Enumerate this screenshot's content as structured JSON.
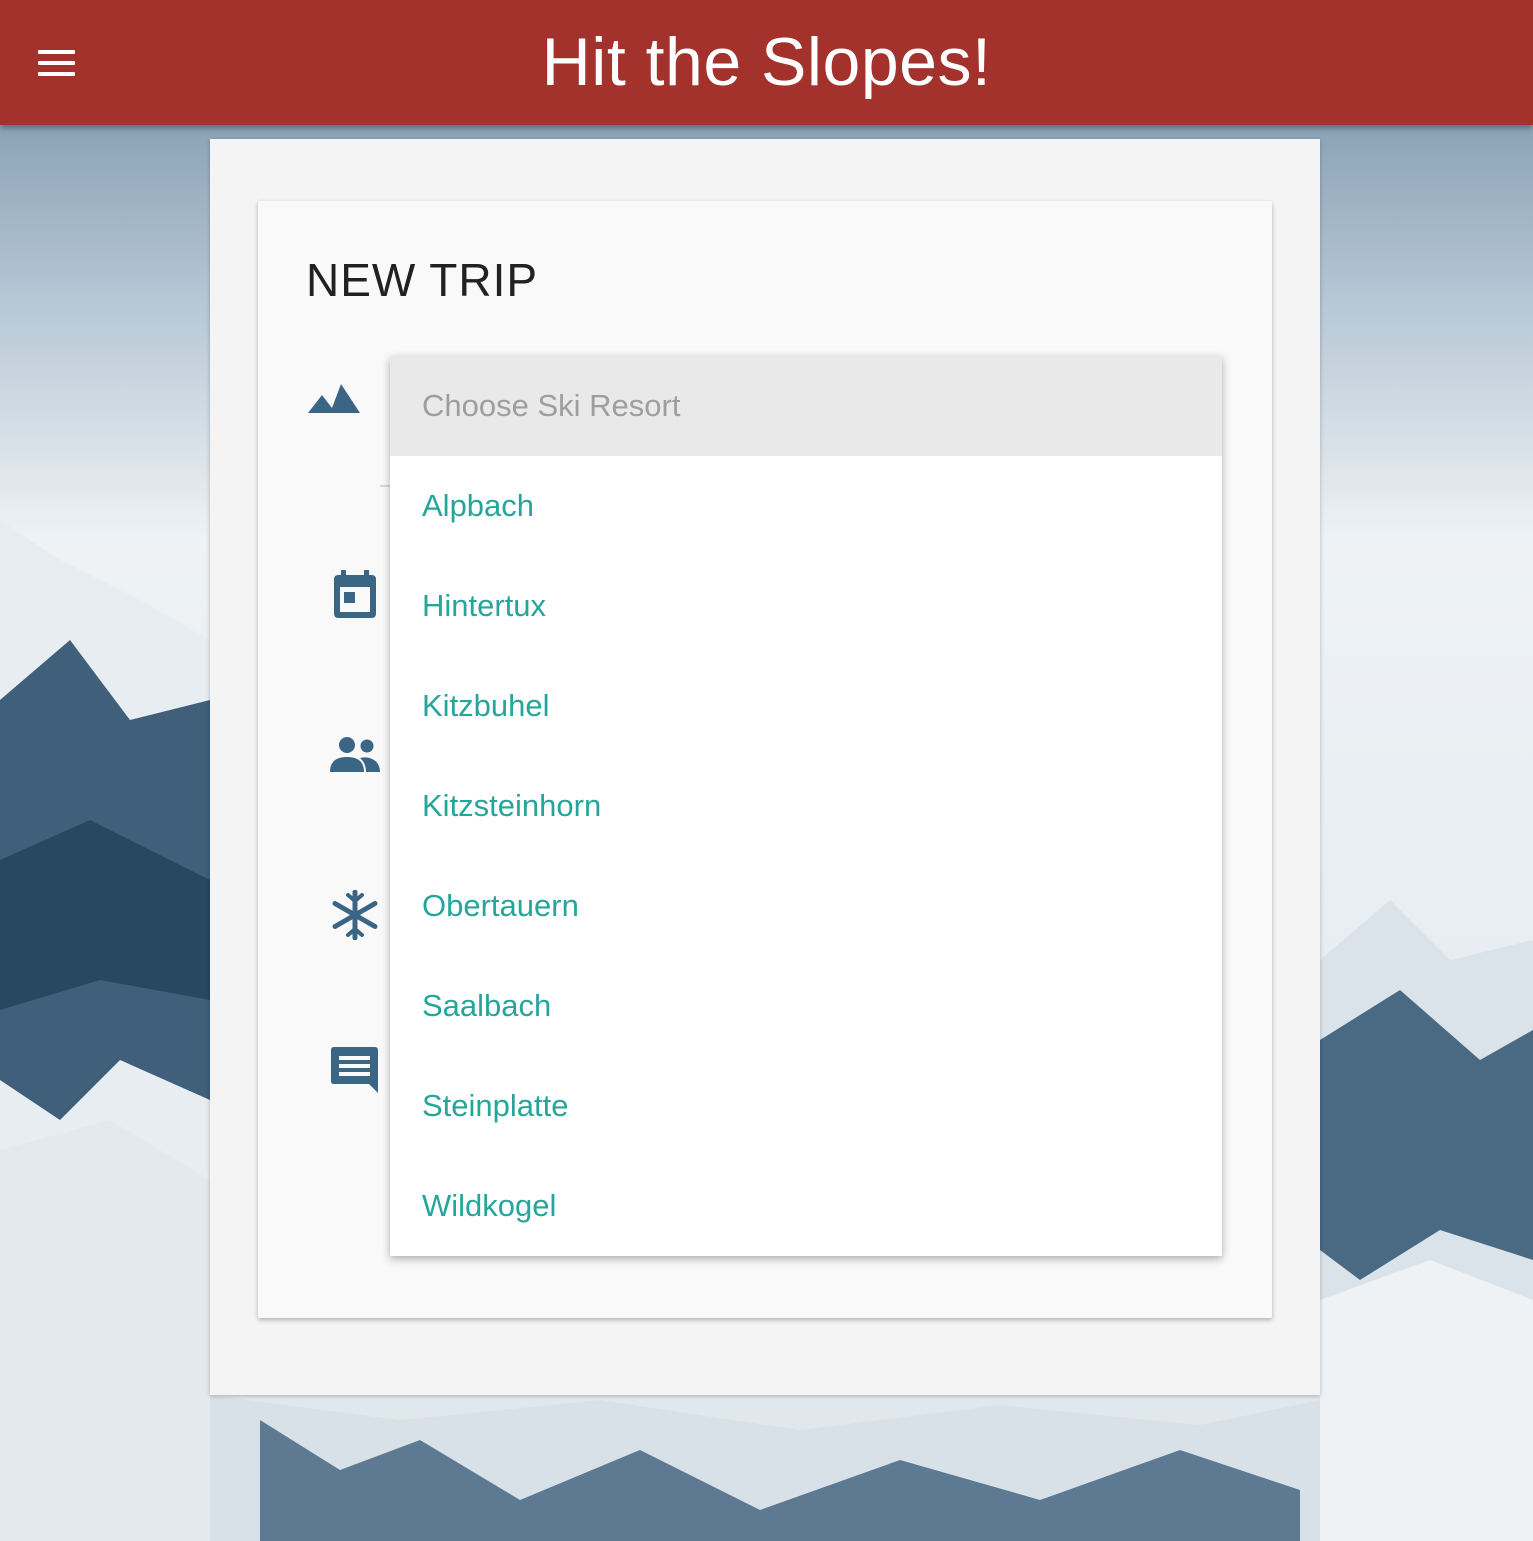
{
  "header": {
    "title": "Hit the Slopes!",
    "menu_icon": "hamburger-menu-icon",
    "background_color": "#a3322d"
  },
  "form": {
    "title": "NEW TRIP",
    "fields": [
      {
        "icon": "mountain-icon"
      },
      {
        "icon": "calendar-icon"
      },
      {
        "icon": "people-icon"
      },
      {
        "icon": "snowflake-icon"
      },
      {
        "icon": "comment-icon"
      }
    ]
  },
  "resort_select": {
    "placeholder": "Choose Ski Resort",
    "options": [
      "Alpbach",
      "Hintertux",
      "Kitzbuhel",
      "Kitzsteinhorn",
      "Obertauern",
      "Saalbach",
      "Steinplatte",
      "Wildkogel"
    ]
  },
  "colors": {
    "accent": "#26a69a",
    "icon": "#3b6584"
  }
}
